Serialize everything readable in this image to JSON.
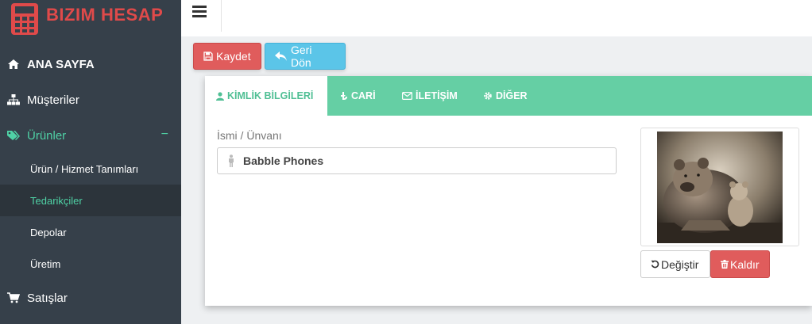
{
  "brand": {
    "name": "BIZIM HESAP",
    "icon": "calculator-icon",
    "color": "#e04a4a"
  },
  "sidebar": {
    "items": [
      {
        "label": "ANA SAYFA",
        "icon": "home-icon"
      },
      {
        "label": "Müşteriler",
        "icon": "sitemap-icon"
      },
      {
        "label": "Ürünler",
        "icon": "tags-icon",
        "expanded_symbol": "−"
      },
      {
        "label": "Satışlar",
        "icon": "cart-icon"
      }
    ],
    "subitems": [
      {
        "label": "Ürün / Hizmet Tanımları"
      },
      {
        "label": "Tedarikçiler"
      },
      {
        "label": "Depolar"
      },
      {
        "label": "Üretim"
      }
    ]
  },
  "toolbar": {
    "save_label": "Kaydet",
    "back_label": "Geri Dön"
  },
  "tabs": [
    {
      "label": "KİMLİK BİLGİLERİ",
      "icon": "user-icon"
    },
    {
      "label": "CARİ",
      "icon": "money-icon"
    },
    {
      "label": "İLETİŞİM",
      "icon": "envelope-icon"
    },
    {
      "label": "DİĞER",
      "icon": "gear-icon"
    }
  ],
  "form": {
    "name_label": "İsmi / Ünvanı",
    "name_value": "Babble Phones"
  },
  "image_actions": {
    "change_label": "Değiştir",
    "remove_label": "Kaldır"
  },
  "colors": {
    "sidebar_bg": "#36404a",
    "accent_green": "#65cfa4",
    "danger": "#e05c5c",
    "info": "#5bc5e8"
  }
}
